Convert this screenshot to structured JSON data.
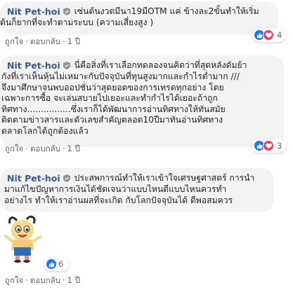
{
  "colors": {
    "author": "#385898",
    "bubble_bg": "#f2f3f5",
    "like_blue": "#1877f2",
    "love_red": "#f33e58",
    "meta_gray": "#606770"
  },
  "comments": [
    {
      "author": "Nit Pet-hoi",
      "text_lines": [
        "เซ่นต้นงวดมีนา19มีOTM แค่ ข้างละ2ขั้นทำให้เริ่ม",
        "ต้นก็ยากที่จะทำตามระบบ (ความเสี่ยงสูง )"
      ],
      "actions": {
        "like": "ถูกใจ",
        "reply": "ตอบกลับ",
        "time": "1 ปี"
      },
      "reactions": {
        "icons": [
          "like-icon",
          "love-icon"
        ],
        "count": "4"
      }
    },
    {
      "author": "Nit Pet-hoi",
      "text_lines": [
        "นี่คือสิ่งที่เราเลือกทดลองจนคิดว่าที่สุดหลังดัมย้า",
        "กังที่เราเห็นหุ้นไม่เหมาะกับปัจจุบันที่ทุนสูงมากและกำไรต่ำมาก ///",
        "จึงมาศึกษาจนพบออปชั่นว่าสุดยอดของการเทรดทุกอย่าง โดย",
        "เฉพาะการซื้อ จะเล่นสบายไปเยอะและทำกำไรได้เยอะถ้าถูก",
        "ทิศทาง................ซึ่งเราก็ได้พัฒนาการอ่านทิศทางให้ทันสมัย",
        "ติดตามข่าวสารและตัวเลขสำคัญตลอด10ปีมาทันอ่านทิศทาง",
        "ตลาดโลกได้ถูกต้องแล้ว"
      ],
      "actions": {
        "like": "ถูกใจ",
        "reply": "ตอบกลับ",
        "time": "1 ปี"
      },
      "reactions": {
        "icons": [
          "like-icon",
          "love-icon"
        ],
        "count": "3"
      }
    },
    {
      "author": "Nit Pet-hoi",
      "text_lines": [
        "ประสพการณ์ทำให้เราเข้าใจเศรษฐศาสตร์ การนำ",
        "มาแก้ไขปัญหาการเงินได้ชัดเจนว่าแบบไหนดีแบบไหนควรทำ",
        "อย่างไร ทำให้เราอ่านผลที่จะเกิด กับโลกปัจจุบันได้ ดีพอสมควร"
      ],
      "sticker": "minion-girl-sticker",
      "actions": {
        "like": "ถูกใจ",
        "reply": "ตอบกลับ",
        "time": "1 ปี"
      },
      "reactions": {
        "icons": [
          "like-icon"
        ],
        "count": "6"
      }
    }
  ]
}
